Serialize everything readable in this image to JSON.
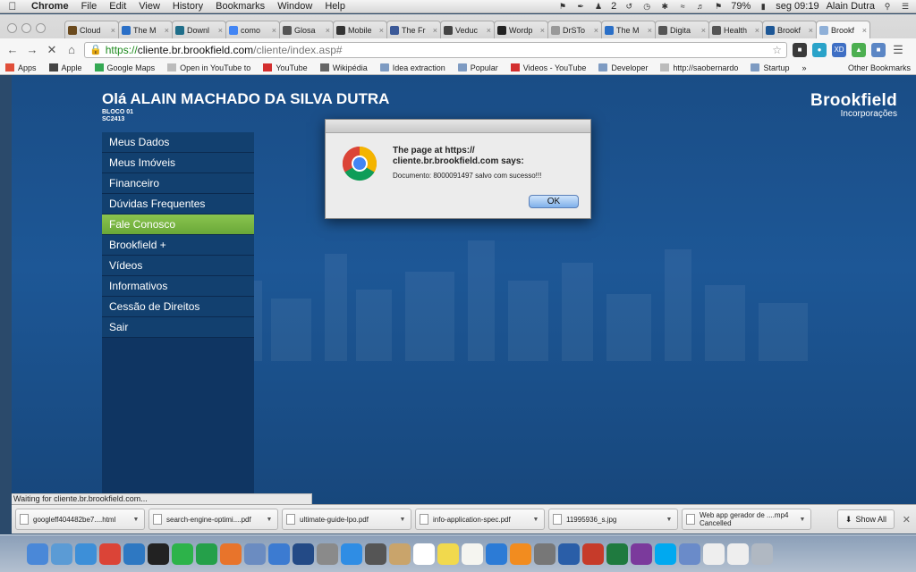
{
  "menubar": {
    "app": "Chrome",
    "items": [
      "File",
      "Edit",
      "View",
      "History",
      "Bookmarks",
      "Window",
      "Help"
    ],
    "battery": "79%",
    "clock": "seg 09:19",
    "user": "Alain Dutra",
    "status_badge": "2"
  },
  "tabs": [
    {
      "label": "Cloud",
      "fav_color": "#6b4a1d",
      "icon": "k-icon"
    },
    {
      "label": "The M",
      "fav_color": "#2a6fc7",
      "icon": "p-icon"
    },
    {
      "label": "Downl",
      "fav_color": "#1f6e8a",
      "icon": "z-icon"
    },
    {
      "label": "como",
      "fav_color": "#4285f4",
      "icon": "google-icon"
    },
    {
      "label": "Glosa",
      "fav_color": "#555555",
      "icon": "wikipedia-icon"
    },
    {
      "label": "Mobile",
      "fav_color": "#333333",
      "icon": "github-icon"
    },
    {
      "label": "The Fr",
      "fav_color": "#3b5998",
      "icon": "facebook-icon"
    },
    {
      "label": "Veduc",
      "fav_color": "#444444",
      "icon": "video-icon"
    },
    {
      "label": "Wordp",
      "fav_color": "#222222",
      "icon": "wordpress-icon"
    },
    {
      "label": "DrSTo",
      "fav_color": "#999999",
      "icon": "page-icon"
    },
    {
      "label": "The M",
      "fav_color": "#2a6fc7",
      "icon": "p-icon"
    },
    {
      "label": "Digita",
      "fav_color": "#555555",
      "icon": "wikipedia-icon"
    },
    {
      "label": "Health",
      "fav_color": "#555555",
      "icon": "wikipedia-icon"
    },
    {
      "label": "Brookf",
      "fav_color": "#1d5796",
      "icon": "brookfield-icon"
    },
    {
      "label": "Brookf",
      "fav_color": "#8fb0d8",
      "icon": "loading-icon",
      "active": true
    }
  ],
  "address": {
    "https": "https://",
    "host": "cliente.br.brookfield.com",
    "path": "/cliente/index.asp#"
  },
  "bookmarks": {
    "items": [
      {
        "label": "Apps",
        "type": "apps"
      },
      {
        "label": "Apple",
        "type": "apple"
      },
      {
        "label": "Google Maps",
        "type": "maps"
      },
      {
        "label": "Open in YouTube to",
        "type": "page"
      },
      {
        "label": "YouTube",
        "type": "youtube"
      },
      {
        "label": "Wikipédia",
        "type": "wiki"
      },
      {
        "label": "Idea extraction",
        "type": "folder"
      },
      {
        "label": "Popular",
        "type": "folder"
      },
      {
        "label": "Videos - YouTube",
        "type": "youtube"
      },
      {
        "label": "Developer",
        "type": "folder"
      },
      {
        "label": "http://saobernardo",
        "type": "page"
      },
      {
        "label": "Startup",
        "type": "folder"
      }
    ],
    "more": "»",
    "other": "Other Bookmarks"
  },
  "page": {
    "greeting": "Olá ALAIN MACHADO DA SILVA DUTRA",
    "block": "BLOCO 01",
    "unit": "SC2413",
    "brand_name": "Brookfield",
    "brand_sub": "Incorporações",
    "menu": [
      "Meus Dados",
      "Meus Imóveis",
      "Financeiro",
      "Dúvidas Frequentes",
      "Fale Conosco",
      "Brookfield +",
      "Vídeos",
      "Informativos",
      "Cessão de Direitos",
      "Sair"
    ],
    "active_menu_index": 4,
    "status": "Waiting for cliente.br.brookfield.com..."
  },
  "dialog": {
    "header": "The page at https:// cliente.br.brookfield.com says:",
    "message": "Documento: 8000091497 salvo com sucesso!!!",
    "ok_label": "OK"
  },
  "downloads": {
    "items": [
      {
        "name": "googleff404482be7....html"
      },
      {
        "name": "search-engine-optimi....pdf"
      },
      {
        "name": "ultimate-guide-lpo.pdf"
      },
      {
        "name": "info-application-spec.pdf"
      },
      {
        "name": "11995936_s.jpg"
      },
      {
        "name": "Web app gerador de ....mp4",
        "status": "Cancelled"
      }
    ],
    "show_all": "Show All"
  },
  "colors": {
    "page_bg": "#1d5796",
    "menu_active": "#7ab845",
    "menu_bg": "#12406f"
  },
  "dock_apps": [
    "finder-icon",
    "mail-icon",
    "safari-icon",
    "chrome-icon",
    "xcode-icon",
    "terminal-icon",
    "evernote-icon",
    "dreamweaver-icon",
    "firefox-icon",
    "preview-icon",
    "keynote-icon",
    "photoshop-icon",
    "app-icon",
    "app-store-icon",
    "facetime-icon",
    "contacts-icon",
    "calendar-icon",
    "stickies-icon",
    "notes-icon",
    "itunes-icon",
    "ibooks-icon",
    "system-preferences-icon",
    "word-icon",
    "powerpoint-icon",
    "excel-icon",
    "onenote-icon",
    "skype-icon",
    "app-icon",
    "document-icon",
    "document-icon",
    "trash-icon"
  ]
}
